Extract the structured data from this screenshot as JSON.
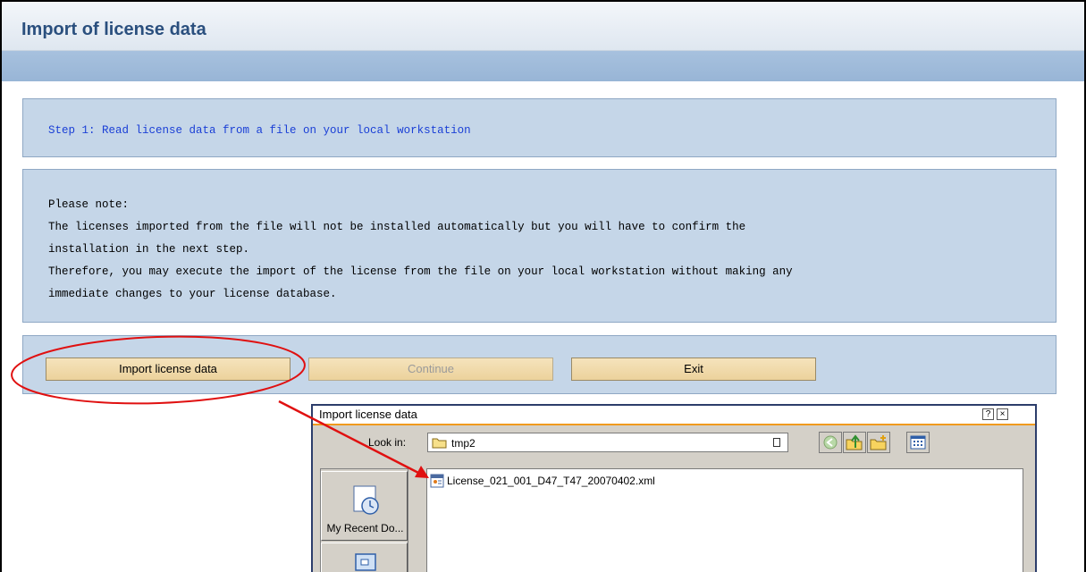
{
  "page": {
    "title": "Import of license data"
  },
  "step": {
    "text": "Step 1: Read license data from a file on your local workstation"
  },
  "note": {
    "lines": [
      "Please note:",
      "The licenses imported from the file will not be installed automatically but you will have to confirm the",
      "installation in the next step.",
      "Therefore, you may execute the import of the license from the file on your local workstation without making any",
      "immediate changes to your license database."
    ]
  },
  "buttons": {
    "import": "Import license data",
    "continue": "Continue",
    "exit": "Exit"
  },
  "dialog": {
    "title": "Import license data",
    "help_glyph": "?",
    "close_glyph": "×",
    "look_in_label": "Look in:",
    "look_in_value": "tmp2",
    "places": {
      "recent": "My Recent Do..."
    },
    "files": [
      {
        "name": "License_021_001_D47_T47_20070402.xml",
        "icon": "xml-file-icon"
      }
    ]
  },
  "annotation": {
    "color": "#e01010",
    "shapes": [
      "highlight-ellipse",
      "pointer-arrow"
    ]
  },
  "colors": {
    "title_text": "#2a4f7e",
    "step_text": "#1a3fd6",
    "panel_bg": "#c5d6e8",
    "button_bg": "#ecd29c",
    "dialog_accent": "#f09a1e"
  }
}
